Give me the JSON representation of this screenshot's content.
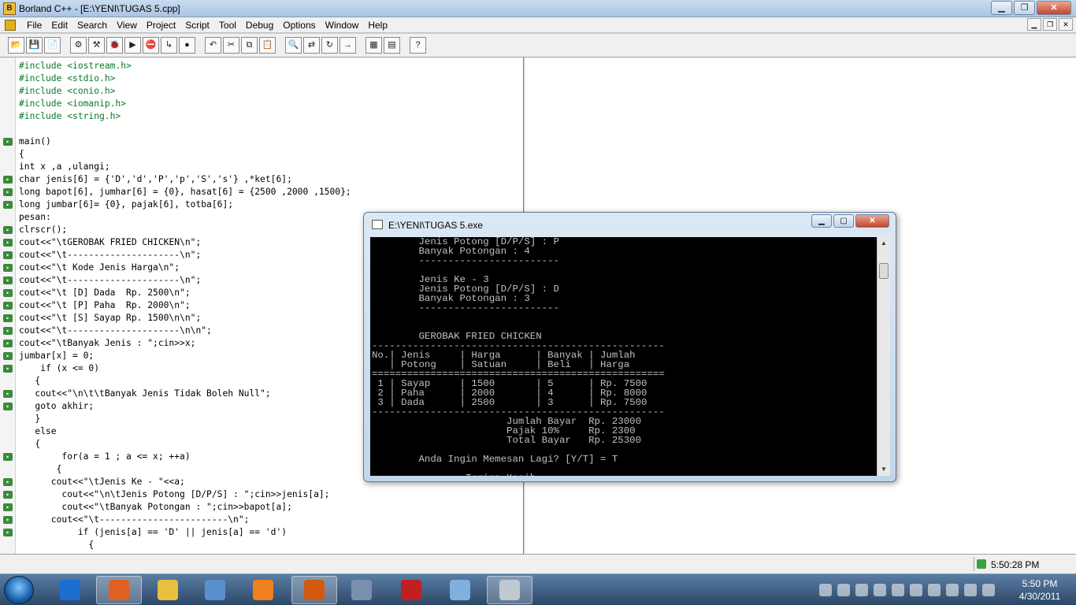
{
  "window": {
    "title": "Borland C++ - [E:\\YENI\\TUGAS 5.cpp]",
    "controls": [
      "minimize",
      "maximize",
      "close"
    ]
  },
  "menu": {
    "items": [
      "File",
      "Edit",
      "Search",
      "View",
      "Project",
      "Script",
      "Tool",
      "Debug",
      "Options",
      "Window",
      "Help"
    ]
  },
  "toolbar": {
    "icons": [
      "open-project-icon",
      "save-icon",
      "open-file-icon",
      "compile-icon",
      "make-icon",
      "debug-icon",
      "run-icon",
      "stop-icon",
      "step-icon",
      "breakpoint-icon",
      "undo-icon",
      "cut-icon",
      "copy-icon",
      "paste-icon",
      "find-icon",
      "replace-icon",
      "search-again-icon",
      "goto-icon",
      "window-icon",
      "layout-icon",
      "help-icon"
    ]
  },
  "editor": {
    "lines": [
      {
        "text": "#include <iostream.h>",
        "color": "green",
        "marker": false
      },
      {
        "text": "#include <stdio.h>",
        "color": "green",
        "marker": false
      },
      {
        "text": "#include <conio.h>",
        "color": "green",
        "marker": false
      },
      {
        "text": "#include <iomanip.h>",
        "color": "green",
        "marker": false
      },
      {
        "text": "#include <string.h>",
        "color": "green",
        "marker": false
      },
      {
        "text": "",
        "color": "black",
        "marker": false
      },
      {
        "text": "main()",
        "color": "black",
        "marker": true
      },
      {
        "text": "{",
        "color": "black",
        "marker": false
      },
      {
        "text": "int x ,a ,ulangi;",
        "color": "black",
        "marker": false
      },
      {
        "text": "char jenis[6] = {'D','d','P','p','S','s'} ,*ket[6];",
        "color": "black",
        "marker": true
      },
      {
        "text": "long bapot[6], jumhar[6] = {0}, hasat[6] = {2500 ,2000 ,1500};",
        "color": "black",
        "marker": true
      },
      {
        "text": "long jumbar[6]= {0}, pajak[6], totba[6];",
        "color": "black",
        "marker": true
      },
      {
        "text": "pesan:",
        "color": "black",
        "marker": false
      },
      {
        "text": "clrscr();",
        "color": "black",
        "marker": true
      },
      {
        "text": "cout<<\"\\tGEROBAK FRIED CHICKEN\\n\";",
        "color": "black",
        "marker": true
      },
      {
        "text": "cout<<\"\\t---------------------\\n\";",
        "color": "black",
        "marker": true
      },
      {
        "text": "cout<<\"\\t Kode Jenis Harga\\n\";",
        "color": "black",
        "marker": true
      },
      {
        "text": "cout<<\"\\t---------------------\\n\";",
        "color": "black",
        "marker": true
      },
      {
        "text": "cout<<\"\\t [D] Dada  Rp. 2500\\n\";",
        "color": "black",
        "marker": true
      },
      {
        "text": "cout<<\"\\t [P] Paha  Rp. 2000\\n\";",
        "color": "black",
        "marker": true
      },
      {
        "text": "cout<<\"\\t [S] Sayap Rp. 1500\\n\\n\";",
        "color": "black",
        "marker": true
      },
      {
        "text": "cout<<\"\\t---------------------\\n\\n\";",
        "color": "black",
        "marker": true
      },
      {
        "text": "cout<<\"\\tBanyak Jenis : \";cin>>x;",
        "color": "black",
        "marker": true
      },
      {
        "text": "jumbar[x] = 0;",
        "color": "black",
        "marker": true
      },
      {
        "text": "    if (x <= 0)",
        "color": "black",
        "marker": true
      },
      {
        "text": "   {",
        "color": "black",
        "marker": false
      },
      {
        "text": "   cout<<\"\\n\\t\\tBanyak Jenis Tidak Boleh Null\";",
        "color": "black",
        "marker": true
      },
      {
        "text": "   goto akhir;",
        "color": "black",
        "marker": true
      },
      {
        "text": "   }",
        "color": "black",
        "marker": false
      },
      {
        "text": "   else",
        "color": "black",
        "marker": false
      },
      {
        "text": "   {",
        "color": "black",
        "marker": false
      },
      {
        "text": "        for(a = 1 ; a <= x; ++a)",
        "color": "black",
        "marker": true
      },
      {
        "text": "       {",
        "color": "black",
        "marker": false
      },
      {
        "text": "      cout<<\"\\tJenis Ke - \"<<a;",
        "color": "black",
        "marker": true
      },
      {
        "text": "        cout<<\"\\n\\tJenis Potong [D/P/S] : \";cin>>jenis[a];",
        "color": "black",
        "marker": true
      },
      {
        "text": "        cout<<\"\\tBanyak Potongan : \";cin>>bapot[a];",
        "color": "black",
        "marker": true
      },
      {
        "text": "      cout<<\"\\t------------------------\\n\";",
        "color": "black",
        "marker": true
      },
      {
        "text": "           if (jenis[a] == 'D' || jenis[a] == 'd')",
        "color": "black",
        "marker": true
      },
      {
        "text": "             {",
        "color": "black",
        "marker": false
      }
    ]
  },
  "console": {
    "title": "E:\\YENI\\TUGAS 5.exe",
    "lines": [
      "        Jenis Potong [D/P/S] : P",
      "        Banyak Potongan : 4",
      "        ------------------------",
      "",
      "        Jenis Ke - 3",
      "        Jenis Potong [D/P/S] : D",
      "        Banyak Potongan : 3",
      "        ------------------------",
      "",
      "",
      "        GEROBAK FRIED CHICKEN",
      "--------------------------------------------------",
      "No.| Jenis     | Harga      | Banyak | Jumlah",
      "   | Potong    | Satuan     | Beli   | Harga",
      "==================================================",
      " 1 | Sayap     | 1500       | 5      | Rp. 7500",
      " 2 | Paha      | 2000       | 4      | Rp. 8000",
      " 3 | Dada      | 2500       | 3      | Rp. 7500",
      "--------------------------------------------------",
      "                       Jumlah Bayar  Rp. 23000",
      "                       Pajak 10%     Rp. 2300",
      "                       Total Bayar   Rp. 25300",
      "",
      "        Anda Ingin Memesan Lagi? [Y/T] = T",
      "",
      "                Terima Kasih"
    ]
  },
  "statusbar": {
    "time": "5:50:28 PM"
  },
  "taskbar": {
    "apps": [
      "internet-explorer-icon",
      "firefox-icon",
      "explorer-folder-icon",
      "calculator-icon",
      "media-player-icon",
      "borland-icon",
      "webcam-icon",
      "smart-icon",
      "paint-icon",
      "console-icon"
    ],
    "clock_time": "5:50 PM",
    "clock_date": "4/30/2011"
  }
}
